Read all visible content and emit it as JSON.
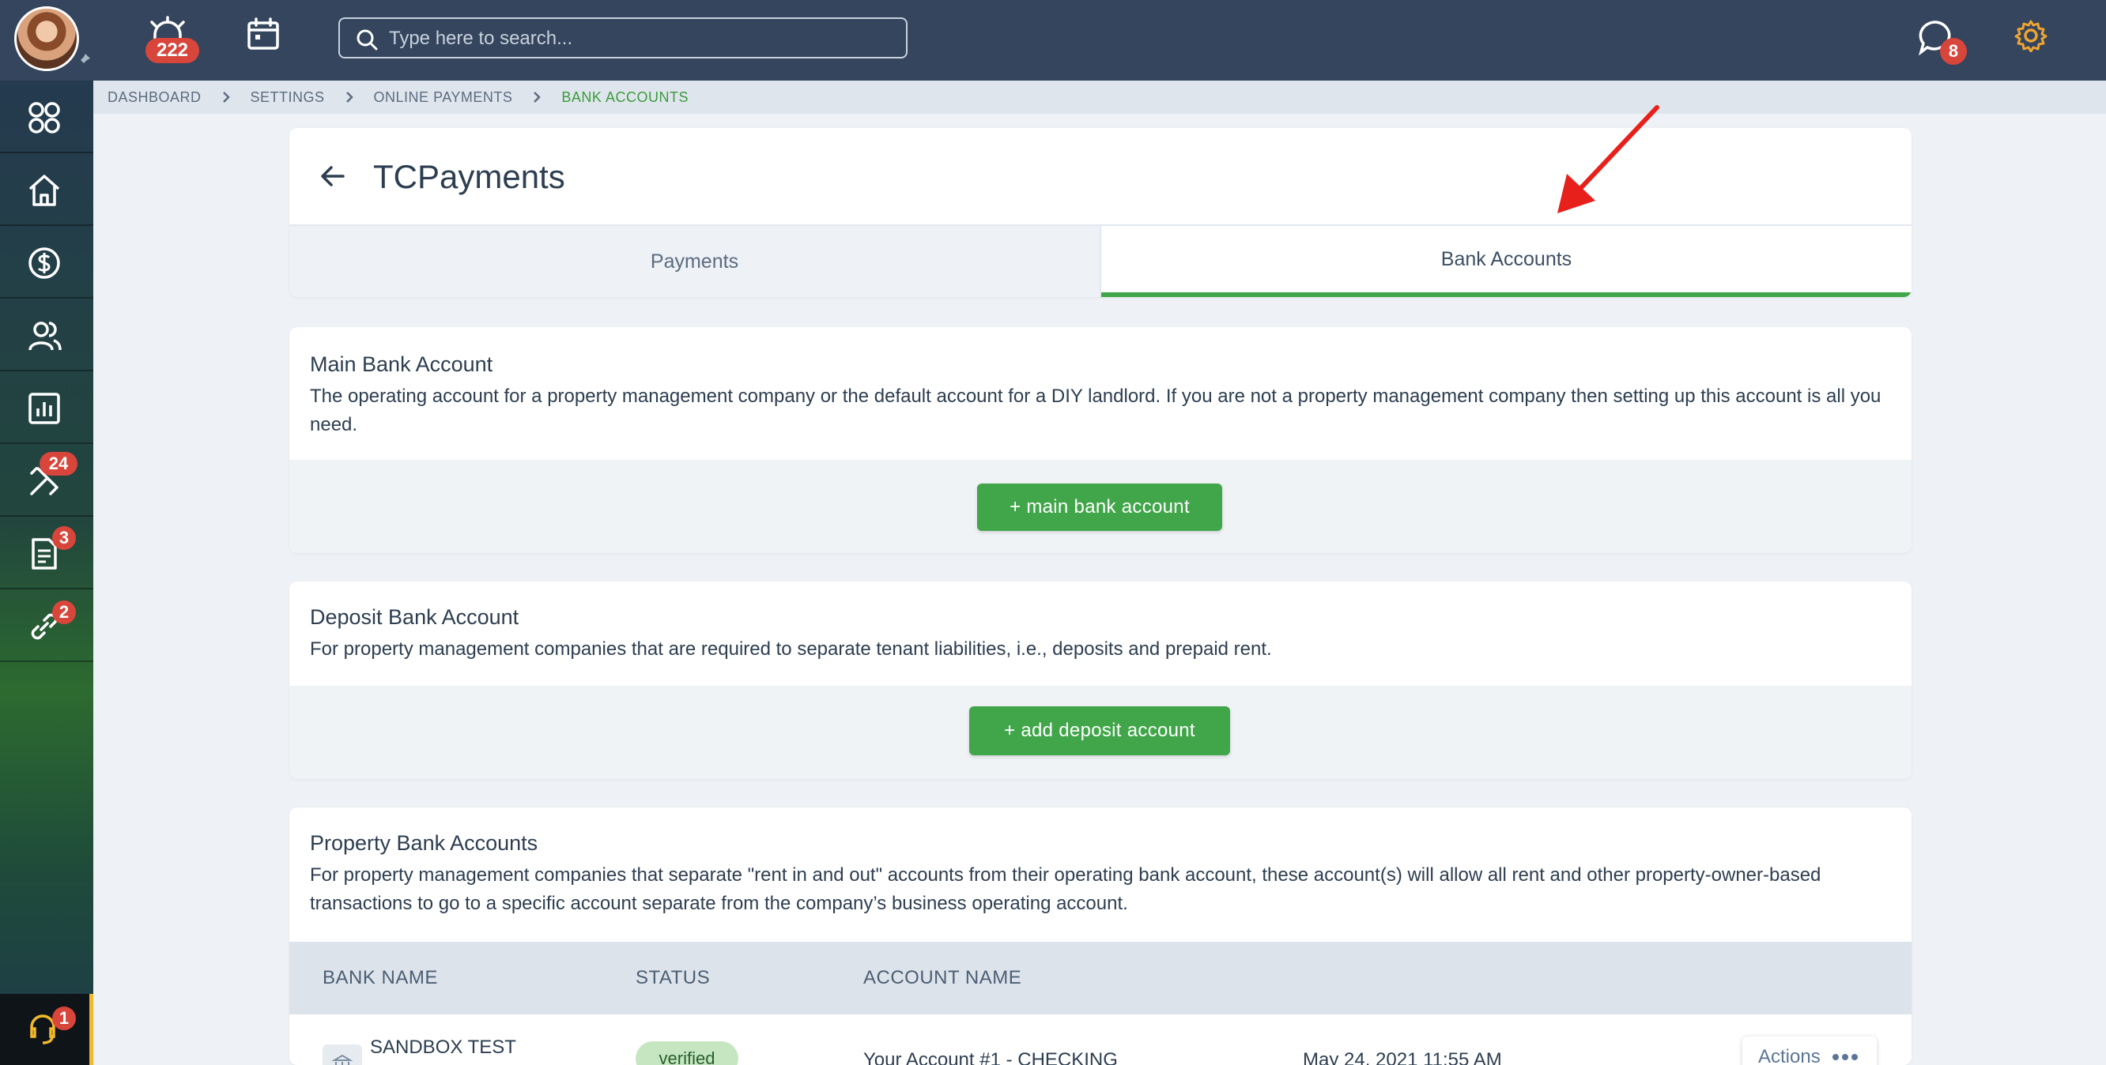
{
  "topbar": {
    "notifications_count": "222",
    "search_placeholder": "Type here to search...",
    "messages_count": "8"
  },
  "sidebar": {
    "items": [
      {
        "icon": "apps-grid-icon",
        "badge": ""
      },
      {
        "icon": "home-icon",
        "badge": ""
      },
      {
        "icon": "dollar-icon",
        "badge": ""
      },
      {
        "icon": "people-icon",
        "badge": ""
      },
      {
        "icon": "reports-icon",
        "badge": ""
      },
      {
        "icon": "tools-icon",
        "badge": "24"
      },
      {
        "icon": "document-icon",
        "badge": "3"
      },
      {
        "icon": "link-icon",
        "badge": "2"
      }
    ],
    "support_badge": "1"
  },
  "breadcrumb": [
    "DASHBOARD",
    "SETTINGS",
    "ONLINE PAYMENTS",
    "BANK ACCOUNTS"
  ],
  "page": {
    "title": "TCPayments",
    "tabs": [
      "Payments",
      "Bank Accounts"
    ]
  },
  "main_bank": {
    "title": "Main Bank Account",
    "description": "The operating account for a property management company or the default account for a DIY landlord. If you are not a property management company then setting up this account is all you need.",
    "button": "+ main bank account"
  },
  "deposit_bank": {
    "title": "Deposit Bank Account",
    "description": "For property management companies that are required to separate tenant liabilities, i.e., deposits and prepaid rent.",
    "button": "+ add deposit account"
  },
  "property_bank": {
    "title": "Property Bank Accounts",
    "description": "For property management companies that separate \"rent in and out\" accounts from their operating bank account, these account(s) will allow all rent and other property-owner-based transactions to go to a specific account separate from the company’s business operating account.",
    "columns": [
      "BANK NAME",
      "STATUS",
      "ACCOUNT NAME"
    ],
    "row": {
      "bank_name": "SANDBOX TEST",
      "status": "verified",
      "account_name": "Your Account #1 - CHECKING",
      "date": "May 24, 2021 11:55 AM",
      "actions": "Actions"
    }
  },
  "colors": {
    "topbar": "#34455d",
    "accent_green": "#41a64a",
    "badge_red": "#d8453b",
    "gear_orange": "#f0a430",
    "annotation_red": "#e8201c"
  }
}
